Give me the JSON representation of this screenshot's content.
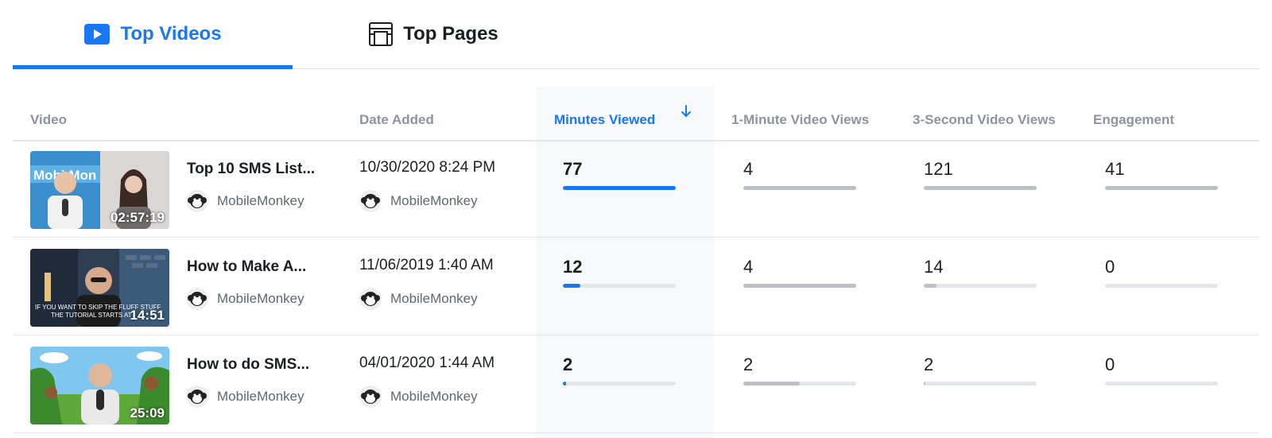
{
  "tabs": [
    {
      "label": "Top Videos",
      "icon": "video-play-icon",
      "active": true
    },
    {
      "label": "Top Pages",
      "icon": "page-layout-icon",
      "active": false
    }
  ],
  "columns": {
    "video": "Video",
    "date_added": "Date Added",
    "minutes_viewed": "Minutes Viewed",
    "one_minute_views": "1-Minute Video Views",
    "three_second_views": "3-Second Video Views",
    "engagement": "Engagement"
  },
  "sort": {
    "column": "minutes_viewed",
    "direction": "descending",
    "icon": "arrow-down-icon"
  },
  "colors": {
    "accent": "#1877f2",
    "muted": "#8d949e",
    "bar_track": "#e4e6eb",
    "bar_fill": "#bcc0c4"
  },
  "rows": [
    {
      "title": "Top 10 SMS List...",
      "owner": "MobileMonkey",
      "duration": "02:57:19",
      "date_added": "10/30/2020 8:24 PM",
      "minutes_viewed": 77,
      "one_minute_views": 4,
      "three_second_views": 121,
      "engagement": 41,
      "bars": {
        "minutes_viewed": 1.0,
        "one_minute_views": 1.0,
        "three_second_views": 1.0,
        "engagement": 1.0
      }
    },
    {
      "title": "How to Make A...",
      "owner": "MobileMonkey",
      "duration": "14:51",
      "date_added": "11/06/2019 1:40 AM",
      "minutes_viewed": 12,
      "one_minute_views": 4,
      "three_second_views": 14,
      "engagement": 0,
      "bars": {
        "minutes_viewed": 0.156,
        "one_minute_views": 1.0,
        "three_second_views": 0.116,
        "engagement": 0
      }
    },
    {
      "title": "How to do SMS...",
      "owner": "MobileMonkey",
      "duration": "25:09",
      "date_added": "04/01/2020 1:44 AM",
      "minutes_viewed": 2,
      "one_minute_views": 2,
      "three_second_views": 2,
      "engagement": 0,
      "bars": {
        "minutes_viewed": 0.026,
        "one_minute_views": 0.5,
        "three_second_views": 0.017,
        "engagement": 0
      }
    }
  ]
}
